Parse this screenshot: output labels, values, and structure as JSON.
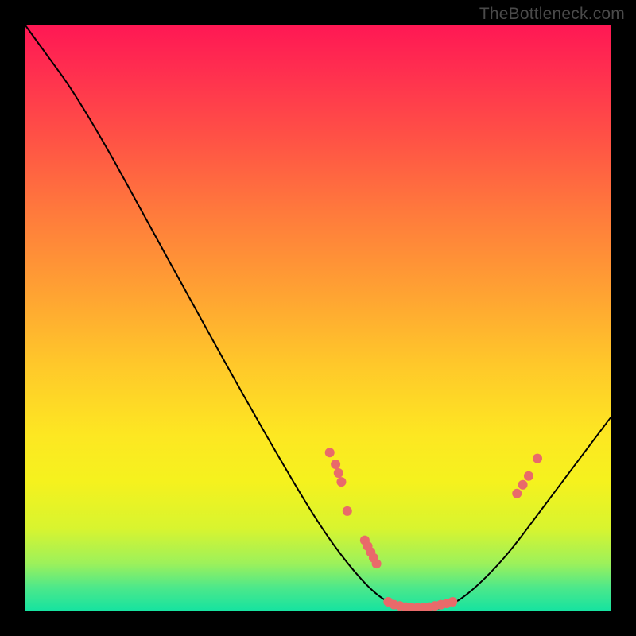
{
  "watermark": "TheBottleneck.com",
  "chart_data": {
    "type": "line",
    "title": "",
    "xlabel": "",
    "ylabel": "",
    "x_range": [
      0,
      100
    ],
    "y_range": [
      0,
      100
    ],
    "grid": false,
    "legend": false,
    "curve": [
      {
        "x": 0.0,
        "y": 100.0
      },
      {
        "x": 4.0,
        "y": 94.5
      },
      {
        "x": 8.0,
        "y": 89.0
      },
      {
        "x": 14.0,
        "y": 79.0
      },
      {
        "x": 20.0,
        "y": 68.0
      },
      {
        "x": 28.0,
        "y": 53.5
      },
      {
        "x": 36.0,
        "y": 39.0
      },
      {
        "x": 44.0,
        "y": 25.0
      },
      {
        "x": 50.0,
        "y": 15.0
      },
      {
        "x": 55.0,
        "y": 8.0
      },
      {
        "x": 60.0,
        "y": 2.5
      },
      {
        "x": 64.0,
        "y": 0.5
      },
      {
        "x": 68.0,
        "y": 0.0
      },
      {
        "x": 72.0,
        "y": 0.5
      },
      {
        "x": 76.0,
        "y": 3.0
      },
      {
        "x": 82.0,
        "y": 9.0
      },
      {
        "x": 88.0,
        "y": 17.0
      },
      {
        "x": 94.0,
        "y": 25.0
      },
      {
        "x": 100.0,
        "y": 33.0
      }
    ],
    "markers": [
      {
        "x": 52.0,
        "y": 27.0
      },
      {
        "x": 53.0,
        "y": 25.0
      },
      {
        "x": 53.5,
        "y": 23.5
      },
      {
        "x": 54.0,
        "y": 22.0
      },
      {
        "x": 55.0,
        "y": 17.0
      },
      {
        "x": 58.0,
        "y": 12.0
      },
      {
        "x": 58.5,
        "y": 11.0
      },
      {
        "x": 59.0,
        "y": 10.0
      },
      {
        "x": 59.5,
        "y": 9.0
      },
      {
        "x": 60.0,
        "y": 8.0
      },
      {
        "x": 62.0,
        "y": 1.5
      },
      {
        "x": 63.0,
        "y": 1.0
      },
      {
        "x": 64.0,
        "y": 0.8
      },
      {
        "x": 65.0,
        "y": 0.6
      },
      {
        "x": 66.0,
        "y": 0.5
      },
      {
        "x": 67.0,
        "y": 0.5
      },
      {
        "x": 68.0,
        "y": 0.5
      },
      {
        "x": 69.0,
        "y": 0.6
      },
      {
        "x": 70.0,
        "y": 0.8
      },
      {
        "x": 71.0,
        "y": 1.0
      },
      {
        "x": 72.0,
        "y": 1.2
      },
      {
        "x": 73.0,
        "y": 1.5
      },
      {
        "x": 84.0,
        "y": 20.0
      },
      {
        "x": 85.0,
        "y": 21.5
      },
      {
        "x": 86.0,
        "y": 23.0
      },
      {
        "x": 87.5,
        "y": 26.0
      }
    ]
  }
}
